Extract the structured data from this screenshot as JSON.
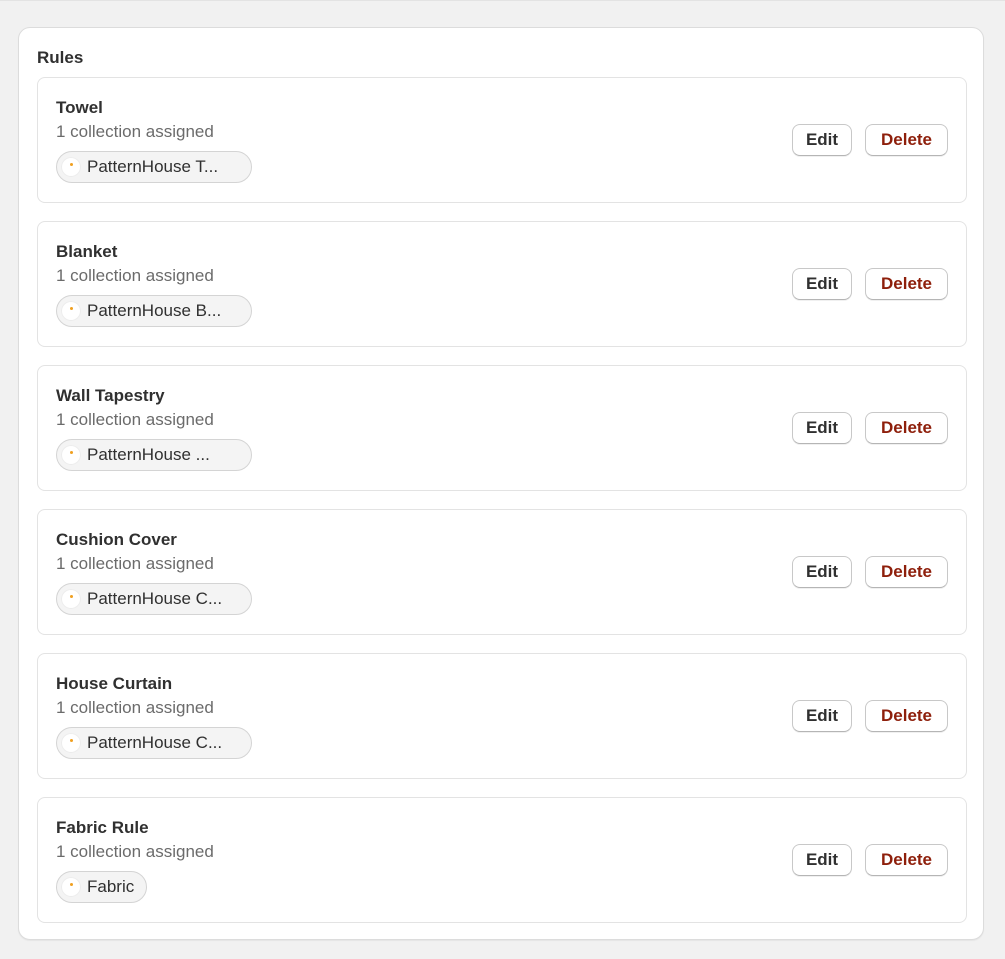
{
  "card": {
    "title": "Rules"
  },
  "rules": [
    {
      "name": "Towel",
      "count": "1 collection assigned",
      "collection": "PatternHouse T...",
      "edit_label": "Edit",
      "delete_label": "Delete"
    },
    {
      "name": "Blanket",
      "count": "1 collection assigned",
      "collection": "PatternHouse B...",
      "edit_label": "Edit",
      "delete_label": "Delete"
    },
    {
      "name": "Wall Tapestry",
      "count": "1 collection assigned",
      "collection": "PatternHouse ...",
      "edit_label": "Edit",
      "delete_label": "Delete"
    },
    {
      "name": "Cushion Cover",
      "count": "1 collection assigned",
      "collection": "PatternHouse C...",
      "edit_label": "Edit",
      "delete_label": "Delete"
    },
    {
      "name": "House Curtain",
      "count": "1 collection assigned",
      "collection": "PatternHouse C...",
      "edit_label": "Edit",
      "delete_label": "Delete"
    },
    {
      "name": "Fabric Rule",
      "count": "1 collection assigned",
      "collection": "Fabric",
      "edit_label": "Edit",
      "delete_label": "Delete"
    }
  ],
  "colors": {
    "background": "#f1f1f1",
    "card": "#ffffff",
    "text": "#303030",
    "muted_text": "#6b6b6b",
    "delete_text": "#8e1f0b"
  },
  "icons": {
    "collection_thumbnail": "collection-thumbnail-icon"
  }
}
